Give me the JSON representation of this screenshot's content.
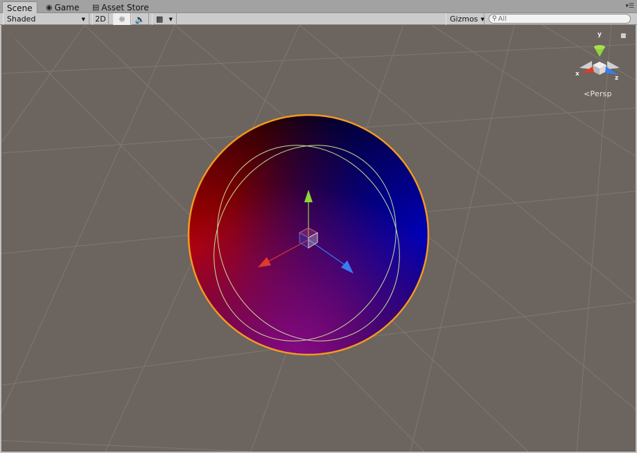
{
  "tabs": [
    {
      "label": "Scene",
      "icon": "",
      "active": true
    },
    {
      "label": "Game",
      "icon": "game-controller-icon",
      "active": false
    },
    {
      "label": "Asset Store",
      "icon": "store-bag-icon",
      "active": false
    }
  ],
  "toolbar": {
    "shading_mode": "Shaded",
    "mode_2d": "2D",
    "gizmos_label": "Gizmos",
    "search_placeholder": "All"
  },
  "orientation_gizmo": {
    "axis_y": "y",
    "axis_x": "x",
    "axis_z": "z",
    "projection_label": "Persp"
  },
  "colors": {
    "viewport_bg": "#6b645f",
    "grid_line": "#7f7873",
    "selection_outline": "#f39a1e",
    "wire_circle": "#c9e49a",
    "axis_x": "#e03a2a",
    "axis_y": "#8fd43a",
    "axis_z": "#3a7bf0"
  }
}
